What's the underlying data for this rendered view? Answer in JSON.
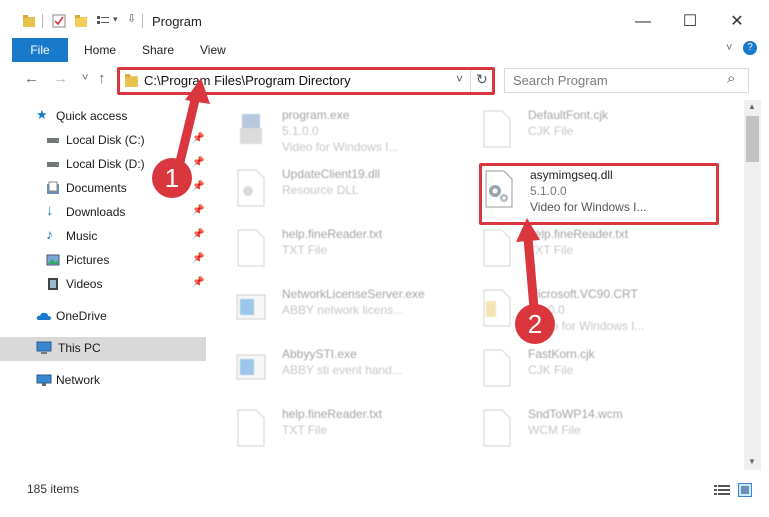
{
  "window": {
    "title": "Program",
    "minimize": "—",
    "maximize": "☐",
    "close": "✕"
  },
  "ribbon": {
    "file": "File",
    "tabs": [
      "Home",
      "Share",
      "View"
    ]
  },
  "nav": {
    "back": "←",
    "forward": "→",
    "recent": "˅",
    "up": "↑",
    "address": "C:\\Program Files\\Program Directory",
    "address_dropdown": "˅",
    "refresh": "↻",
    "search_placeholder": "Search Program",
    "search_icon": "⌕"
  },
  "sidebar": {
    "items": [
      {
        "label": "Quick access",
        "icon": "star-icon",
        "pinned": false
      },
      {
        "label": "Local Disk (C:)",
        "icon": "drive-icon",
        "pinned": true
      },
      {
        "label": "Local Disk (D:)",
        "icon": "drive-icon",
        "pinned": true
      },
      {
        "label": "Documents",
        "icon": "documents-icon",
        "pinned": true
      },
      {
        "label": "Downloads",
        "icon": "download-icon",
        "pinned": true
      },
      {
        "label": "Music",
        "icon": "music-icon",
        "pinned": true
      },
      {
        "label": "Pictures",
        "icon": "pictures-icon",
        "pinned": true
      },
      {
        "label": "Videos",
        "icon": "videos-icon",
        "pinned": true
      },
      {
        "label": "OneDrive",
        "icon": "cloud-icon",
        "pinned": false
      },
      {
        "label": "This PC",
        "icon": "pc-icon",
        "pinned": false,
        "selected": true
      },
      {
        "label": "Network",
        "icon": "network-icon",
        "pinned": false
      }
    ],
    "pin_glyph": "📌"
  },
  "files": [
    {
      "name": "program.exe",
      "line2": "5.1.0.0",
      "line3": "Video for Windows I...",
      "icon": "exe-icon"
    },
    {
      "name": "DefaultFont.cjk",
      "line2": "CJK File",
      "line3": "",
      "icon": "file-icon"
    },
    {
      "name": "UpdateClient19.dll",
      "line2": "Resource DLL",
      "line3": "",
      "icon": "dll-icon"
    },
    {
      "name": "asymimgseq.dll",
      "line2": "5.1.0.0",
      "line3": "Video for Windows I...",
      "icon": "dll-gear-icon",
      "highlighted": true
    },
    {
      "name": "help.fineReader.txt",
      "line2": "TXT File",
      "line3": "",
      "icon": "file-icon"
    },
    {
      "name": "help.fineReader.txt",
      "line2": "TXT File",
      "line3": "",
      "icon": "file-icon"
    },
    {
      "name": "NetworkLicenseServer.exe",
      "line2": "ABBY network licens...",
      "line3": "",
      "icon": "app-window-icon"
    },
    {
      "name": "Microsoft.VC90.CRT",
      "line2": "5.1.0.0",
      "line3": "Video for Windows I...",
      "icon": "folder-file-icon"
    },
    {
      "name": "AbbyySTI.exe",
      "line2": "ABBY sti event hand...",
      "line3": "",
      "icon": "app-window-icon"
    },
    {
      "name": "FastKorn.cjk",
      "line2": "CJK File",
      "line3": "",
      "icon": "file-icon"
    },
    {
      "name": "help.fineReader.txt",
      "line2": "TXT File",
      "line3": "",
      "icon": "file-icon"
    },
    {
      "name": "SndToWP14.wcm",
      "line2": "WCM File",
      "line3": "",
      "icon": "file-icon"
    }
  ],
  "status": {
    "item_count": "185 items"
  },
  "annotations": {
    "step1": "1",
    "step2": "2"
  },
  "colors": {
    "accent": "#1979ca",
    "annotation": "#d9363e",
    "selected": "#cce8ff"
  }
}
